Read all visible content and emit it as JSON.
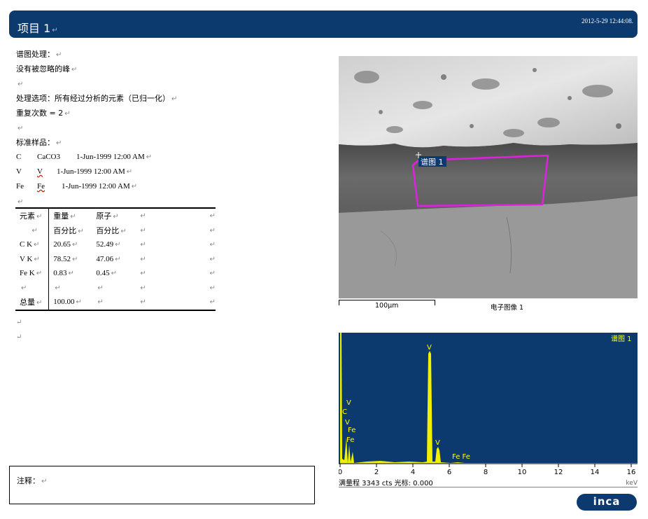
{
  "header": {
    "title": "项目 1",
    "date": "2012-5-29 12:44:08."
  },
  "left": {
    "spectrum_processing_label": "谱图处理：",
    "no_peaks_omitted": "没有被忽略的峰",
    "processing_options": "处理选项：所有经过分析的元素（已归一化）",
    "iterations": "重复次数 = 2",
    "standards_label": "标准样品：",
    "standards": [
      {
        "element": "C",
        "compound": "CaCO3",
        "date": "1-Jun-1999 12:00 AM"
      },
      {
        "element": "V",
        "compound": "V",
        "date": "1-Jun-1999 12:00 AM"
      },
      {
        "element": "Fe",
        "compound": "Fe",
        "date": "1-Jun-1999 12:00 AM"
      }
    ]
  },
  "table": {
    "header_row1": [
      "元素",
      "重量",
      "原子"
    ],
    "header_row2": [
      "",
      "百分比",
      "百分比"
    ],
    "rows": [
      {
        "element": "C K",
        "weight": "20.65",
        "atomic": "52.49"
      },
      {
        "element": "V K",
        "weight": "78.52",
        "atomic": "47.06"
      },
      {
        "element": "Fe K",
        "weight": "0.83",
        "atomic": "0.45"
      },
      {
        "element": "",
        "weight": "",
        "atomic": ""
      }
    ],
    "total_label": "总量",
    "total_value": "100.00"
  },
  "notes_label": "注释：",
  "sem": {
    "region_label": "谱图 1",
    "scale": "100µm",
    "image_label": "电子图像 1"
  },
  "spectrum": {
    "title": "谱图 1",
    "x_ticks": [
      "0",
      "2",
      "4",
      "6",
      "8",
      "10",
      "12",
      "14",
      "16"
    ],
    "unit": "keV",
    "footer": "满量程 3343 cts 光标: 0.000",
    "peak_labels": {
      "v_main": "V",
      "v_kb": "V",
      "c": "C",
      "v_l1": "V",
      "v_l2": "V",
      "fe_l1": "Fe",
      "fe_l2": "Fe",
      "fe_k": "Fe Fe"
    }
  },
  "logo": "inca"
}
